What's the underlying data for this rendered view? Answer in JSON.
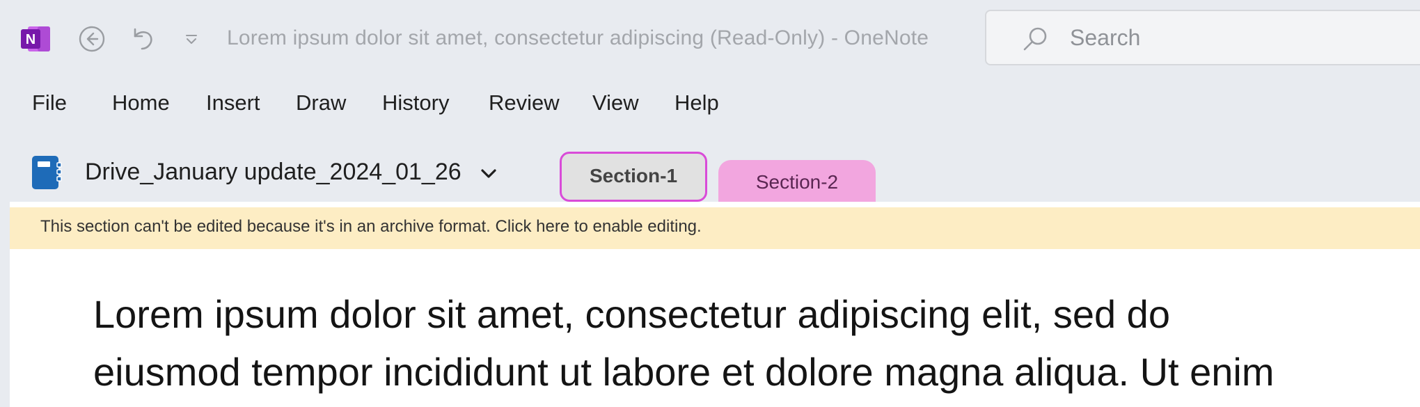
{
  "titlebar": {
    "app_name": "OneNote",
    "window_title": "Lorem ipsum dolor sit amet, consectetur adipiscing (Read-Only)  -  OneNote",
    "search_placeholder": "Search",
    "logo_letter": "N"
  },
  "menu": {
    "items": [
      "File",
      "Home",
      "Insert",
      "Draw",
      "History",
      "Review",
      "View",
      "Help"
    ]
  },
  "notebook": {
    "title": "Drive_January update_2024_01_26",
    "sections": [
      {
        "label": "Section-1",
        "active": true,
        "color": "#e1e1e1",
        "outline": "#d94bd8"
      },
      {
        "label": "Section-2",
        "active": false,
        "color": "#f2a6df"
      }
    ]
  },
  "info_bar": {
    "message": "This section can't be edited because it's in an archive format. Click here to enable editing.",
    "color": "#fdedc4"
  },
  "page": {
    "lines": [
      "Lorem ipsum dolor sit amet, consectetur adipiscing elit, sed do",
      "eiusmod tempor incididunt ut labore et dolore magna aliqua. Ut enim"
    ]
  },
  "colors": {
    "background": "#e8ebf0",
    "onenote_purple": "#7719aa"
  }
}
